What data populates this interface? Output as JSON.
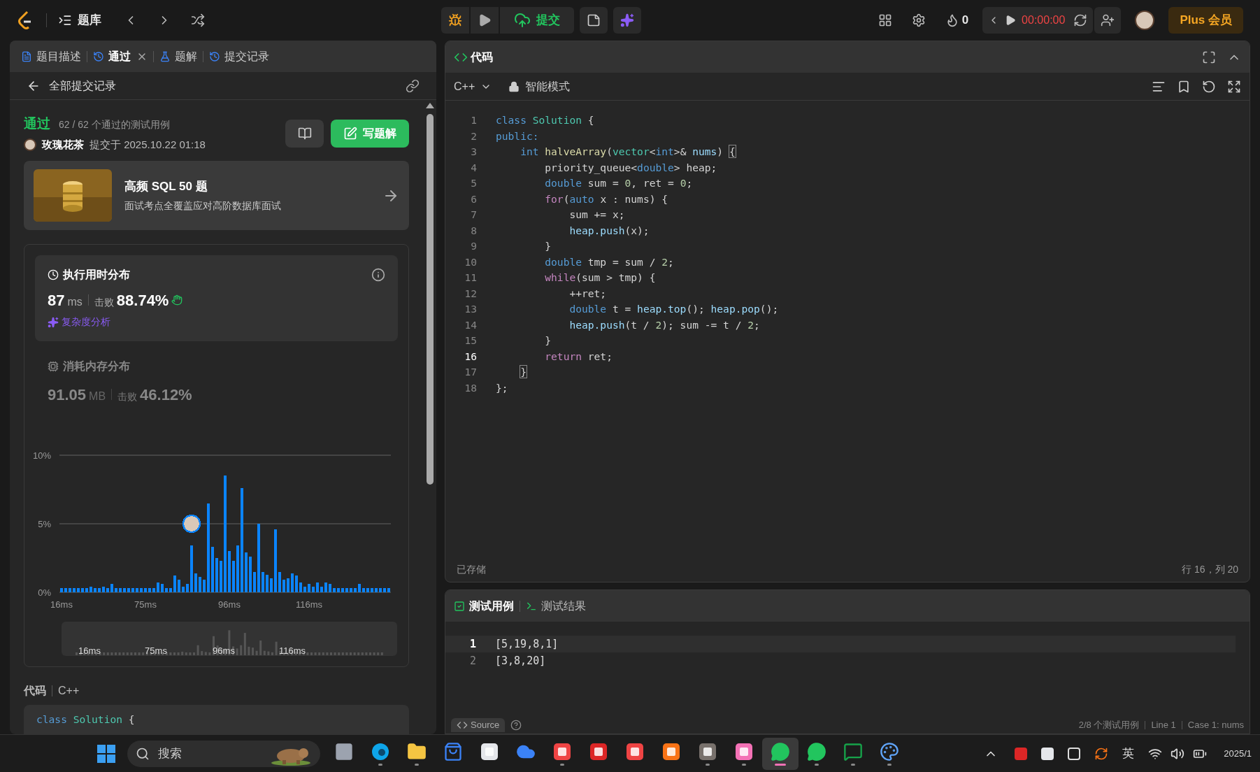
{
  "top_bar": {
    "problem_bank": "题库",
    "submit": "提交",
    "streak": "0",
    "timer": "00:00:00",
    "plus": "Plus 会员"
  },
  "left_panel": {
    "tabs": [
      {
        "label": "题目描述",
        "kind": "doc",
        "selected": false,
        "closable": false
      },
      {
        "label": "通过",
        "kind": "history",
        "selected": true,
        "closable": true
      },
      {
        "label": "题解",
        "kind": "flask",
        "selected": false,
        "closable": false
      },
      {
        "label": "提交记录",
        "kind": "history",
        "selected": false,
        "closable": false
      }
    ],
    "back_label": "全部提交记录",
    "result": {
      "status": "通过",
      "cases": "62 / 62 个通过的测试用例",
      "user": "玫瑰花茶",
      "submitted": "提交于 2025.10.22 01:18",
      "write_solution": "写题解"
    },
    "promo": {
      "title": "高频 SQL 50 题",
      "subtitle": "面试考点全覆盖应对高阶数据库面试"
    },
    "runtime": {
      "selected": true,
      "title": "执行用时分布",
      "value": "87",
      "unit": "ms",
      "beats_label": "击败",
      "beats": "88.74%",
      "analysis": "复杂度分析"
    },
    "memory": {
      "selected": false,
      "title": "消耗内存分布",
      "value": "91.05",
      "unit": "MB",
      "beats_label": "击败",
      "beats": "46.12%",
      "chart_data": {
        "type": "bar",
        "categories": [
          "16ms",
          null,
          null,
          null,
          null,
          null,
          null,
          null,
          null,
          null,
          null,
          null,
          null,
          null,
          null,
          null,
          null,
          null,
          null,
          null,
          "75ms",
          null,
          null,
          null,
          null,
          null,
          null,
          null,
          null,
          null,
          null,
          null,
          null,
          null,
          null,
          null,
          null,
          null,
          null,
          null,
          "96ms",
          null,
          null,
          null,
          null,
          null,
          null,
          null,
          null,
          null,
          null,
          null,
          null,
          null,
          null,
          null,
          null,
          null,
          null,
          "116ms",
          null,
          null,
          null,
          null,
          null,
          null,
          null,
          null,
          null,
          null,
          null,
          null,
          null,
          null,
          null,
          null,
          null,
          null,
          null
        ],
        "values": [
          0.3,
          0.3,
          0.3,
          0.3,
          0.3,
          0.3,
          0.3,
          0.4,
          0.3,
          0.3,
          0.4,
          0.3,
          0.6,
          0.3,
          0.3,
          0.3,
          0.3,
          0.3,
          0.3,
          0.3,
          0.3,
          0.3,
          0.3,
          0.7,
          0.6,
          0.3,
          0.3,
          1.2,
          0.9,
          0.4,
          0.6,
          3.4,
          1.4,
          1.1,
          0.9,
          6.5,
          3.3,
          2.5,
          2.3,
          8.5,
          3.0,
          2.3,
          3.4,
          7.6,
          2.9,
          2.6,
          1.5,
          5.0,
          1.5,
          1.3,
          1.0,
          4.6,
          1.5,
          0.9,
          1.0,
          1.4,
          1.2,
          0.7,
          0.4,
          0.6,
          0.4,
          0.7,
          0.4,
          0.7,
          0.6,
          0.3,
          0.3,
          0.3,
          0.3,
          0.3,
          0.3,
          0.6,
          0.3,
          0.3,
          0.3,
          0.3,
          0.3,
          0.3,
          0.3
        ],
        "ylim": [
          0,
          10
        ],
        "yticks": [
          {
            "value": 0,
            "label": "0%"
          },
          {
            "value": 5,
            "label": "5%"
          },
          {
            "value": 10,
            "label": "10%"
          }
        ]
      },
      "navigator_labels": [
        "16ms",
        "75ms",
        "96ms",
        "116ms"
      ]
    },
    "code_section": {
      "title": "代码",
      "language": "C++",
      "first_line": [
        {
          "kind": "kw",
          "text": "class "
        },
        {
          "kind": "type",
          "text": "Solution"
        },
        {
          "kind": "plain",
          "text": " {"
        }
      ]
    }
  },
  "editor": {
    "title": "代码",
    "language": "C++",
    "mode": "智能模式",
    "lines": [
      {
        "number": "1",
        "current": false,
        "tokens": [
          {
            "kind": "kw",
            "text": "class "
          },
          {
            "kind": "type",
            "text": "Solution"
          },
          {
            "kind": "plain",
            "text": " {"
          }
        ]
      },
      {
        "number": "2",
        "current": false,
        "tokens": [
          {
            "kind": "kw",
            "text": "public:"
          }
        ]
      },
      {
        "number": "3",
        "current": false,
        "tokens": [
          {
            "kind": "kw",
            "text": "    int "
          },
          {
            "kind": "fn",
            "text": "halveArray"
          },
          {
            "kind": "plain",
            "text": "("
          },
          {
            "kind": "type",
            "text": "vector"
          },
          {
            "kind": "plain",
            "text": "<"
          },
          {
            "kind": "kw",
            "text": "int"
          },
          {
            "kind": "plain",
            "text": ">& "
          },
          {
            "kind": "var",
            "text": "nums"
          },
          {
            "kind": "plain",
            "text": ") "
          },
          {
            "kind": "match",
            "text": "{"
          }
        ]
      },
      {
        "number": "4",
        "current": false,
        "tokens": [
          {
            "kind": "plain",
            "text": "        priority_queue<"
          },
          {
            "kind": "kw",
            "text": "double"
          },
          {
            "kind": "plain",
            "text": "> heap;"
          }
        ]
      },
      {
        "number": "5",
        "current": false,
        "tokens": [
          {
            "kind": "kw",
            "text": "        double"
          },
          {
            "kind": "plain",
            "text": " sum = "
          },
          {
            "kind": "num",
            "text": "0"
          },
          {
            "kind": "plain",
            "text": ", ret = "
          },
          {
            "kind": "num",
            "text": "0"
          },
          {
            "kind": "plain",
            "text": ";"
          }
        ]
      },
      {
        "number": "6",
        "current": false,
        "tokens": [
          {
            "kind": "ctrl",
            "text": "        for"
          },
          {
            "kind": "plain",
            "text": "("
          },
          {
            "kind": "kw",
            "text": "auto"
          },
          {
            "kind": "plain",
            "text": " x : nums) {"
          }
        ]
      },
      {
        "number": "7",
        "current": false,
        "tokens": [
          {
            "kind": "plain",
            "text": "            sum += x;"
          }
        ]
      },
      {
        "number": "8",
        "current": false,
        "tokens": [
          {
            "kind": "var",
            "text": "            heap.push"
          },
          {
            "kind": "plain",
            "text": "(x);"
          }
        ]
      },
      {
        "number": "9",
        "current": false,
        "tokens": [
          {
            "kind": "plain",
            "text": "        }"
          }
        ]
      },
      {
        "number": "10",
        "current": false,
        "tokens": [
          {
            "kind": "kw",
            "text": "        double"
          },
          {
            "kind": "plain",
            "text": " tmp = sum / "
          },
          {
            "kind": "num",
            "text": "2"
          },
          {
            "kind": "plain",
            "text": ";"
          }
        ]
      },
      {
        "number": "11",
        "current": false,
        "tokens": [
          {
            "kind": "ctrl",
            "text": "        while"
          },
          {
            "kind": "plain",
            "text": "(sum > tmp) {"
          }
        ]
      },
      {
        "number": "12",
        "current": false,
        "tokens": [
          {
            "kind": "plain",
            "text": "            ++ret;"
          }
        ]
      },
      {
        "number": "13",
        "current": false,
        "tokens": [
          {
            "kind": "kw",
            "text": "            double"
          },
          {
            "kind": "plain",
            "text": " t = "
          },
          {
            "kind": "var",
            "text": "heap.top"
          },
          {
            "kind": "plain",
            "text": "(); "
          },
          {
            "kind": "var",
            "text": "heap.pop"
          },
          {
            "kind": "plain",
            "text": "();"
          }
        ]
      },
      {
        "number": "14",
        "current": false,
        "tokens": [
          {
            "kind": "var",
            "text": "            heap.push"
          },
          {
            "kind": "plain",
            "text": "(t / "
          },
          {
            "kind": "num",
            "text": "2"
          },
          {
            "kind": "plain",
            "text": "); sum -= t / "
          },
          {
            "kind": "num",
            "text": "2"
          },
          {
            "kind": "plain",
            "text": ";"
          }
        ]
      },
      {
        "number": "15",
        "current": false,
        "tokens": [
          {
            "kind": "plain",
            "text": "        }"
          }
        ]
      },
      {
        "number": "16",
        "current": true,
        "tokens": [
          {
            "kind": "ctrl",
            "text": "        return"
          },
          {
            "kind": "plain",
            "text": " ret;"
          }
        ]
      },
      {
        "number": "17",
        "current": false,
        "tokens": [
          {
            "kind": "match",
            "text": "    }"
          }
        ]
      },
      {
        "number": "18",
        "current": false,
        "tokens": [
          {
            "kind": "plain",
            "text": "};"
          }
        ]
      }
    ],
    "saved": "已存储",
    "cursor": "行 16，列 20"
  },
  "testcase_panel": {
    "tabs": [
      {
        "label": "测试用例",
        "kind": "check",
        "selected": true
      },
      {
        "label": "测试结果",
        "kind": "terminal",
        "selected": false
      }
    ],
    "lines": [
      {
        "number": "1",
        "text": "[5,19,8,1]",
        "selected": true
      },
      {
        "number": "2",
        "text": "[3,8,20]",
        "selected": false
      }
    ],
    "source": "Source",
    "status": [
      "2/8 个测试用例",
      "Line 1",
      "Case 1: nums"
    ]
  },
  "taskbar": {
    "search_placeholder": "搜索",
    "ime": "英",
    "clock": "2025/1",
    "apps": [
      {
        "kind": "taskview",
        "active": false,
        "running": false
      },
      {
        "kind": "browser",
        "active": false,
        "running": true
      },
      {
        "kind": "folder",
        "active": false,
        "running": true
      },
      {
        "kind": "store",
        "active": false,
        "running": false
      },
      {
        "kind": "m",
        "active": false,
        "running": false
      },
      {
        "kind": "cloud",
        "active": false,
        "running": false
      },
      {
        "kind": "wps",
        "active": false,
        "running": true
      },
      {
        "kind": "g",
        "active": false,
        "running": false
      },
      {
        "kind": "huawei",
        "active": false,
        "running": false
      },
      {
        "kind": "c",
        "active": false,
        "running": false
      },
      {
        "kind": "ide",
        "active": false,
        "running": true
      },
      {
        "kind": "bili",
        "active": false,
        "running": true
      },
      {
        "kind": "chat",
        "active": true,
        "running": true
      },
      {
        "kind": "chat",
        "active": false,
        "running": true
      },
      {
        "kind": "message",
        "active": false,
        "running": true
      },
      {
        "kind": "paint",
        "active": false,
        "running": true
      }
    ]
  }
}
